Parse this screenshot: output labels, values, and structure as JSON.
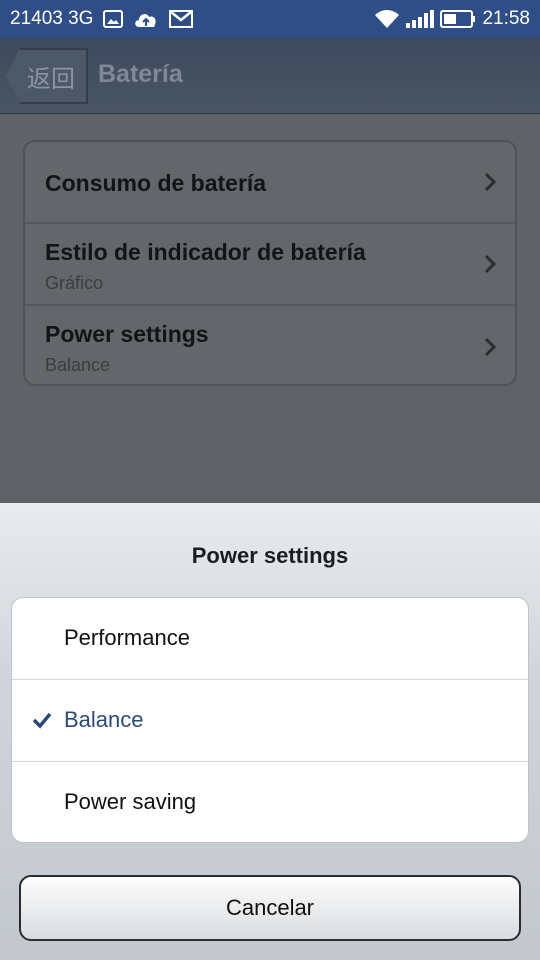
{
  "status_bar": {
    "carrier": "21403 3G",
    "time": "21:58",
    "left_icons": [
      "image-icon",
      "cloud-upload-icon",
      "gmail-icon"
    ],
    "right_icons": [
      "wifi-icon",
      "signal-icon",
      "battery-icon"
    ]
  },
  "action_bar": {
    "back_label": "返回",
    "title": "Batería"
  },
  "settings": {
    "items": [
      {
        "title": "Consumo de batería",
        "subtitle": ""
      },
      {
        "title": "Estilo de indicador de batería",
        "subtitle": "Gráfico"
      },
      {
        "title": "Power settings",
        "subtitle": "Balance"
      }
    ]
  },
  "dialog": {
    "title": "Power settings",
    "options": [
      {
        "label": "Performance",
        "selected": false
      },
      {
        "label": "Balance",
        "selected": true
      },
      {
        "label": "Power saving",
        "selected": false
      }
    ],
    "cancel_label": "Cancelar"
  },
  "colors": {
    "status_bar": "#2f4e88",
    "selected_option": "#2b4a7c",
    "dim_overlay": "#5f6266"
  }
}
